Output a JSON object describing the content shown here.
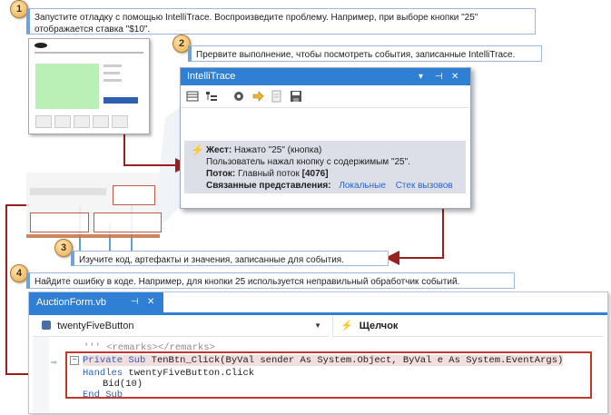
{
  "steps": [
    {
      "num": "1",
      "text": "Запустите отладку с помощью IntelliTrace. Воспроизведите проблему. Например, при выборе кнопки \"25\" отображается ставка \"$10\"."
    },
    {
      "num": "2",
      "text": "Прервите выполнение, чтобы посмотреть события, записанные IntelliTrace."
    },
    {
      "num": "3",
      "text": "Изучите код, артефакты и значения, записанные для события."
    },
    {
      "num": "4",
      "text": "Найдите ошибку в коде. Например, для кнопки 25 используется неправильный обработчик событий."
    }
  ],
  "intellitrace": {
    "title": "IntelliTrace",
    "title_controls": [
      "▾",
      "⊣",
      "✕"
    ],
    "toolbar_icons": [
      "list-view-icon",
      "tree-view-icon",
      "settings-icon",
      "step-arrow-icon",
      "open-log-icon",
      "save-icon"
    ],
    "event": {
      "gesture_label": "Жест:",
      "gesture_value": "Нажато \"25\" (кнопка)",
      "description": "Пользователь нажал кнопку с содержимым \"25\".",
      "thread_label": "Поток:",
      "thread_value": "Главный поток",
      "thread_id": "[4076]",
      "related_label": "Связанные представления:",
      "link_locals": "Локальные",
      "link_callstack": "Стек вызовов"
    }
  },
  "editor": {
    "tab_title": "AuctionForm.vb",
    "tab_pin": "⊣",
    "tab_close": "✕",
    "member_dropdown": "twentyFiveButton",
    "event_dropdown": "Щелчок",
    "code_lines": {
      "remarks": "''' <remarks></remarks>",
      "sig_kw1": "Private",
      "sig_kw2": "Sub",
      "sig_rest": "TenBtn_Click(ByVal sender As System.Object, ByVal e As System.EventArgs)",
      "handles_kw": "Handles",
      "handles_rest": "twentyFiveButton.Click",
      "body": "Bid(10)",
      "end_kw": "End Sub"
    }
  },
  "colors": {
    "accent_blue": "#2f7fd4",
    "arrow_red": "#9c1f1f",
    "highlight_border": "#c0392b",
    "event_panel": "#dcdfe8"
  }
}
